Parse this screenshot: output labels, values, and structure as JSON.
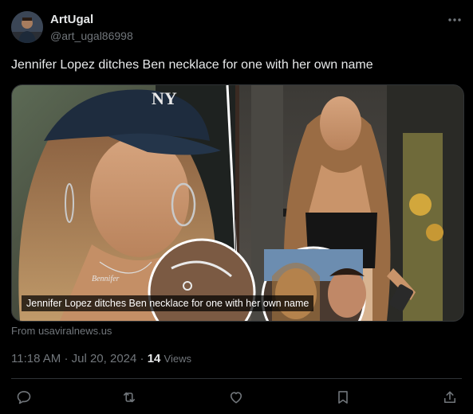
{
  "author": {
    "display_name": "ArtUgal",
    "handle": "@art_ugal86998"
  },
  "tweet": {
    "text": "Jennifer Lopez ditches Ben necklace for one with her own name"
  },
  "media": {
    "caption": "Jennifer Lopez ditches Ben necklace for one with her own name",
    "cap_logo_text": "NY",
    "necklace_text": "Bennifer"
  },
  "source": {
    "label": "From usaviralnews.us"
  },
  "meta": {
    "time": "11:18 AM",
    "separator": "·",
    "date": "Jul 20, 2024",
    "views_count": "14",
    "views_label": "Views"
  },
  "actions": {
    "icons": [
      "reply-icon",
      "retweet-icon",
      "like-icon",
      "bookmark-icon",
      "share-icon"
    ]
  },
  "colors": {
    "background": "#000000",
    "text_primary": "#e7e9ea",
    "text_secondary": "#71767b",
    "divider": "#2f3336"
  }
}
